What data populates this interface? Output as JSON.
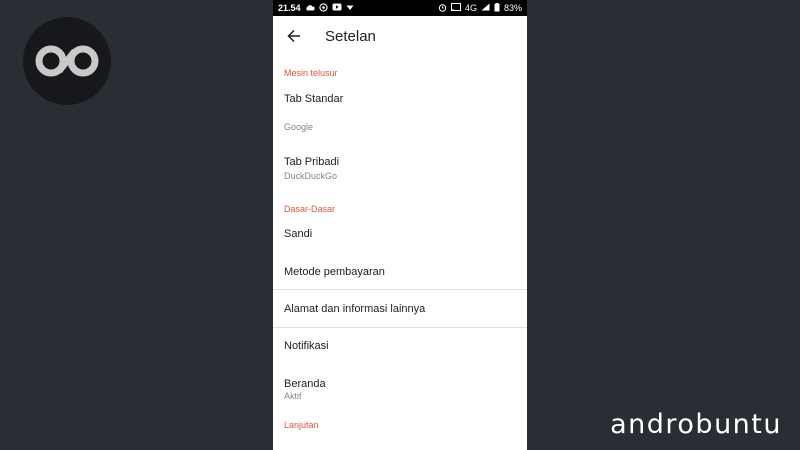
{
  "watermark": {
    "brand": "androbuntu"
  },
  "status_bar": {
    "time": "21.54",
    "network": "4G",
    "battery": "83%"
  },
  "app_bar": {
    "title": "Setelan"
  },
  "sections": {
    "search_engine": {
      "header": "Mesin telusur",
      "items": [
        {
          "label": "Tab Standar",
          "value": "Google"
        },
        {
          "label": "Tab Pribadi",
          "value": "DuckDuckGo"
        }
      ]
    },
    "basics": {
      "header": "Dasar-Dasar",
      "items": [
        {
          "label": "Sandi"
        },
        {
          "label": "Metode pembayaran"
        },
        {
          "label": "Alamat dan informasi lainnya"
        },
        {
          "label": "Notifikasi"
        },
        {
          "label": "Beranda",
          "value": "Aktif"
        }
      ]
    },
    "advanced": {
      "header": "Lanjutan"
    }
  },
  "colors": {
    "accent": "#e2553b",
    "background": "#2a2d33"
  }
}
